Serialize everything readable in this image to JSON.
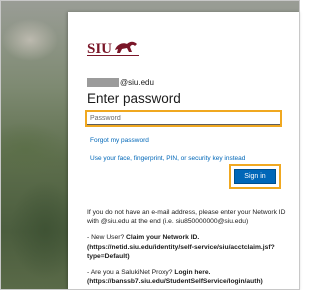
{
  "login": {
    "email_suffix": "@siu.edu",
    "title": "Enter password",
    "password_placeholder": "Password",
    "forgot_link": "Forgot my password",
    "alt_signin_link": "Use your face, fingerprint, PIN, or security key instead",
    "signin_button": "Sign in"
  },
  "info": {
    "paragraph1": "If you do not have an e-mail address, please enter your Network ID with @siu.edu at the end (i.e. siu850000000@siu.edu)",
    "new_user_prefix": "- New User? ",
    "new_user_bold": "Claim your Network ID. (https://netid.siu.edu/identity/self-service/siu/acctclaim.jsf?type=Default)",
    "proxy_prefix": "- Are you a SalukiNet Proxy? ",
    "proxy_bold": "Login here. (https://banssb7.siu.edu/StudentSelfService/login/auth)"
  },
  "logo": {
    "text": "SIU",
    "colors": {
      "maroon": "#7a1628",
      "accent": "#0067b8",
      "highlight": "#f0a820"
    }
  }
}
